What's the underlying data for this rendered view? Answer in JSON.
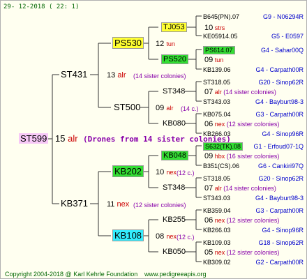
{
  "header": {
    "date": "29- 12-2018 ( 22:  1)"
  },
  "footer": {
    "copyright": "Copyright 2004-2018 @ Karl Kehrle Foundation",
    "website": "www.pedigreeapis.org"
  },
  "root": {
    "name": "ST599",
    "gen": "15",
    "race": "alr",
    "note": "(Drones from 14 sister colonies)"
  },
  "gen1": [
    {
      "name": "ST431",
      "gen": "13",
      "race": "alr",
      "note": "(14 sister colonies)"
    },
    {
      "name": "KB371",
      "gen": "11",
      "race": "nex",
      "note": "(12 sister colonies)"
    }
  ],
  "gen2": [
    {
      "name": "PS530",
      "gen": "12",
      "race": "tun",
      "note": ""
    },
    {
      "name": "ST500",
      "gen": "09",
      "race": "alr",
      "note": "(14 c.)"
    },
    {
      "name": "KB202",
      "gen": "10",
      "race": "nex",
      "note": "(12 c.)"
    },
    {
      "name": "KB108",
      "gen": "08",
      "race": "nex",
      "note": "(12 c.)"
    }
  ],
  "gen3": [
    {
      "name": "TJ053",
      "gen": "10",
      "race": "strs",
      "note": ""
    },
    {
      "name": "PS520",
      "gen": "09",
      "race": "tun",
      "note": ""
    },
    {
      "name": "ST348",
      "gen": "07",
      "race": "alr",
      "note": "(14 sister colonies)"
    },
    {
      "name": "KB080",
      "gen": "06",
      "race": "nex",
      "note": "(12 sister colonies)"
    },
    {
      "name": "KB048",
      "gen": "09",
      "race": "hbx",
      "note": "(16 sister colonies)"
    },
    {
      "name": "ST348",
      "gen": "07",
      "race": "alr",
      "note": "(14 sister colonies)"
    },
    {
      "name": "KB255",
      "gen": "06",
      "race": "nex",
      "note": "(12 sister colonies)"
    },
    {
      "name": "KB050",
      "gen": "05",
      "race": "nex",
      "note": "(12 sister colonies)"
    }
  ],
  "gen4": [
    {
      "name": "B645(PN).07",
      "ref": "G9 - N06294R"
    },
    {
      "name": "KE05914.05",
      "ref": "G5 - E0597"
    },
    {
      "name": "PS614.07",
      "ref": "G4 - Sahar00Q"
    },
    {
      "name": "KB139.06",
      "ref": "G4 - Carpath00R"
    },
    {
      "name": "ST318.05",
      "ref": "G20 - Sinop62R"
    },
    {
      "name": "ST343.03",
      "ref": "G4 - Bayburt98-3"
    },
    {
      "name": "KB075.04",
      "ref": "G3 - Carpath00R"
    },
    {
      "name": "KB266.03",
      "ref": "G4 - Sinop96R"
    },
    {
      "name": "S632(TK).08",
      "ref": "G1 - Erfoud07-1Q"
    },
    {
      "name": "B351(CS).06",
      "ref": "G6 - Cankiri97Q"
    },
    {
      "name": "ST318.05",
      "ref": "G20 - Sinop62R"
    },
    {
      "name": "ST343.03",
      "ref": "G4 - Bayburt98-3"
    },
    {
      "name": "KB359.04",
      "ref": "G3 - Carpath00R"
    },
    {
      "name": "KB266.03",
      "ref": "G4 - Sinop96R"
    },
    {
      "name": "KB109.03",
      "ref": "G18 - Sinop62R"
    },
    {
      "name": "KB309.02",
      "ref": "G2 - Carpath00R"
    }
  ]
}
